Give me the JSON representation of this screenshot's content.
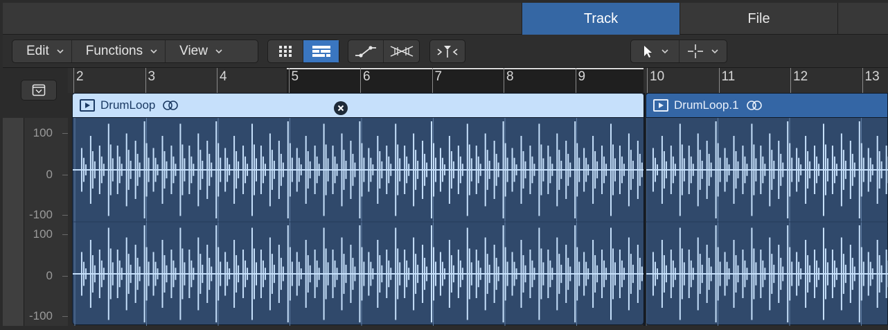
{
  "tabs": [
    {
      "label": "Track",
      "active": true
    },
    {
      "label": "File",
      "active": false
    }
  ],
  "toolbar": {
    "menus": [
      {
        "label": "Edit"
      },
      {
        "label": "Functions"
      },
      {
        "label": "View"
      }
    ],
    "view_buttons": [
      "grid-view-icon",
      "list-view-icon"
    ],
    "tool_buttons": [
      "automation-curve-icon",
      "flex-waveform-icon"
    ],
    "catch_button": "catch-playhead-icon",
    "pointer_tool": "pointer-tool-icon",
    "marquee_tool": "crosshair-tool-icon"
  },
  "ruler": {
    "bars": [
      "2",
      "3",
      "4",
      "5",
      "6",
      "7",
      "8",
      "9",
      "10",
      "11",
      "12",
      "13"
    ]
  },
  "scale": {
    "upper": {
      "top": "100",
      "mid": "0",
      "bottom": "-100"
    },
    "lower": {
      "top": "100",
      "mid": "0",
      "bottom": "-100"
    }
  },
  "regions": [
    {
      "name": "DrumLoop",
      "selected": true,
      "color": "#c6e0fb"
    },
    {
      "name": "DrumLoop.1",
      "selected": false,
      "color": "#3466a5"
    }
  ],
  "colors": {
    "accent": "#3567a4",
    "waveform": "#c6e0fb",
    "region_body": "#30496b"
  }
}
